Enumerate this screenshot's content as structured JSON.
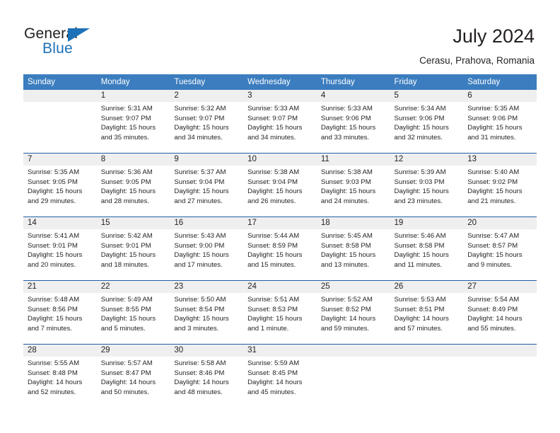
{
  "brand": {
    "name_dark": "General",
    "name_blue": "Blue",
    "accent_color": "#1d72b8"
  },
  "header": {
    "title": "July 2024",
    "subtitle": "Cerasu, Prahova, Romania",
    "header_bg": "#3b7dbf",
    "separator_color": "#1f60a8",
    "daynum_bg": "#efefef"
  },
  "weekdays": [
    "Sunday",
    "Monday",
    "Tuesday",
    "Wednesday",
    "Thursday",
    "Friday",
    "Saturday"
  ],
  "calendar": {
    "month": "July",
    "year": "2024",
    "weeks": [
      [
        {
          "day": "",
          "lines": []
        },
        {
          "day": "1",
          "lines": [
            "Sunrise: 5:31 AM",
            "Sunset: 9:07 PM",
            "Daylight: 15 hours",
            "and 35 minutes."
          ]
        },
        {
          "day": "2",
          "lines": [
            "Sunrise: 5:32 AM",
            "Sunset: 9:07 PM",
            "Daylight: 15 hours",
            "and 34 minutes."
          ]
        },
        {
          "day": "3",
          "lines": [
            "Sunrise: 5:33 AM",
            "Sunset: 9:07 PM",
            "Daylight: 15 hours",
            "and 34 minutes."
          ]
        },
        {
          "day": "4",
          "lines": [
            "Sunrise: 5:33 AM",
            "Sunset: 9:06 PM",
            "Daylight: 15 hours",
            "and 33 minutes."
          ]
        },
        {
          "day": "5",
          "lines": [
            "Sunrise: 5:34 AM",
            "Sunset: 9:06 PM",
            "Daylight: 15 hours",
            "and 32 minutes."
          ]
        },
        {
          "day": "6",
          "lines": [
            "Sunrise: 5:35 AM",
            "Sunset: 9:06 PM",
            "Daylight: 15 hours",
            "and 31 minutes."
          ]
        }
      ],
      [
        {
          "day": "7",
          "lines": [
            "Sunrise: 5:35 AM",
            "Sunset: 9:05 PM",
            "Daylight: 15 hours",
            "and 29 minutes."
          ]
        },
        {
          "day": "8",
          "lines": [
            "Sunrise: 5:36 AM",
            "Sunset: 9:05 PM",
            "Daylight: 15 hours",
            "and 28 minutes."
          ]
        },
        {
          "day": "9",
          "lines": [
            "Sunrise: 5:37 AM",
            "Sunset: 9:04 PM",
            "Daylight: 15 hours",
            "and 27 minutes."
          ]
        },
        {
          "day": "10",
          "lines": [
            "Sunrise: 5:38 AM",
            "Sunset: 9:04 PM",
            "Daylight: 15 hours",
            "and 26 minutes."
          ]
        },
        {
          "day": "11",
          "lines": [
            "Sunrise: 5:38 AM",
            "Sunset: 9:03 PM",
            "Daylight: 15 hours",
            "and 24 minutes."
          ]
        },
        {
          "day": "12",
          "lines": [
            "Sunrise: 5:39 AM",
            "Sunset: 9:03 PM",
            "Daylight: 15 hours",
            "and 23 minutes."
          ]
        },
        {
          "day": "13",
          "lines": [
            "Sunrise: 5:40 AM",
            "Sunset: 9:02 PM",
            "Daylight: 15 hours",
            "and 21 minutes."
          ]
        }
      ],
      [
        {
          "day": "14",
          "lines": [
            "Sunrise: 5:41 AM",
            "Sunset: 9:01 PM",
            "Daylight: 15 hours",
            "and 20 minutes."
          ]
        },
        {
          "day": "15",
          "lines": [
            "Sunrise: 5:42 AM",
            "Sunset: 9:01 PM",
            "Daylight: 15 hours",
            "and 18 minutes."
          ]
        },
        {
          "day": "16",
          "lines": [
            "Sunrise: 5:43 AM",
            "Sunset: 9:00 PM",
            "Daylight: 15 hours",
            "and 17 minutes."
          ]
        },
        {
          "day": "17",
          "lines": [
            "Sunrise: 5:44 AM",
            "Sunset: 8:59 PM",
            "Daylight: 15 hours",
            "and 15 minutes."
          ]
        },
        {
          "day": "18",
          "lines": [
            "Sunrise: 5:45 AM",
            "Sunset: 8:58 PM",
            "Daylight: 15 hours",
            "and 13 minutes."
          ]
        },
        {
          "day": "19",
          "lines": [
            "Sunrise: 5:46 AM",
            "Sunset: 8:58 PM",
            "Daylight: 15 hours",
            "and 11 minutes."
          ]
        },
        {
          "day": "20",
          "lines": [
            "Sunrise: 5:47 AM",
            "Sunset: 8:57 PM",
            "Daylight: 15 hours",
            "and 9 minutes."
          ]
        }
      ],
      [
        {
          "day": "21",
          "lines": [
            "Sunrise: 5:48 AM",
            "Sunset: 8:56 PM",
            "Daylight: 15 hours",
            "and 7 minutes."
          ]
        },
        {
          "day": "22",
          "lines": [
            "Sunrise: 5:49 AM",
            "Sunset: 8:55 PM",
            "Daylight: 15 hours",
            "and 5 minutes."
          ]
        },
        {
          "day": "23",
          "lines": [
            "Sunrise: 5:50 AM",
            "Sunset: 8:54 PM",
            "Daylight: 15 hours",
            "and 3 minutes."
          ]
        },
        {
          "day": "24",
          "lines": [
            "Sunrise: 5:51 AM",
            "Sunset: 8:53 PM",
            "Daylight: 15 hours",
            "and 1 minute."
          ]
        },
        {
          "day": "25",
          "lines": [
            "Sunrise: 5:52 AM",
            "Sunset: 8:52 PM",
            "Daylight: 14 hours",
            "and 59 minutes."
          ]
        },
        {
          "day": "26",
          "lines": [
            "Sunrise: 5:53 AM",
            "Sunset: 8:51 PM",
            "Daylight: 14 hours",
            "and 57 minutes."
          ]
        },
        {
          "day": "27",
          "lines": [
            "Sunrise: 5:54 AM",
            "Sunset: 8:49 PM",
            "Daylight: 14 hours",
            "and 55 minutes."
          ]
        }
      ],
      [
        {
          "day": "28",
          "lines": [
            "Sunrise: 5:55 AM",
            "Sunset: 8:48 PM",
            "Daylight: 14 hours",
            "and 52 minutes."
          ]
        },
        {
          "day": "29",
          "lines": [
            "Sunrise: 5:57 AM",
            "Sunset: 8:47 PM",
            "Daylight: 14 hours",
            "and 50 minutes."
          ]
        },
        {
          "day": "30",
          "lines": [
            "Sunrise: 5:58 AM",
            "Sunset: 8:46 PM",
            "Daylight: 14 hours",
            "and 48 minutes."
          ]
        },
        {
          "day": "31",
          "lines": [
            "Sunrise: 5:59 AM",
            "Sunset: 8:45 PM",
            "Daylight: 14 hours",
            "and 45 minutes."
          ]
        },
        {
          "day": "",
          "lines": []
        },
        {
          "day": "",
          "lines": []
        },
        {
          "day": "",
          "lines": []
        }
      ]
    ]
  }
}
